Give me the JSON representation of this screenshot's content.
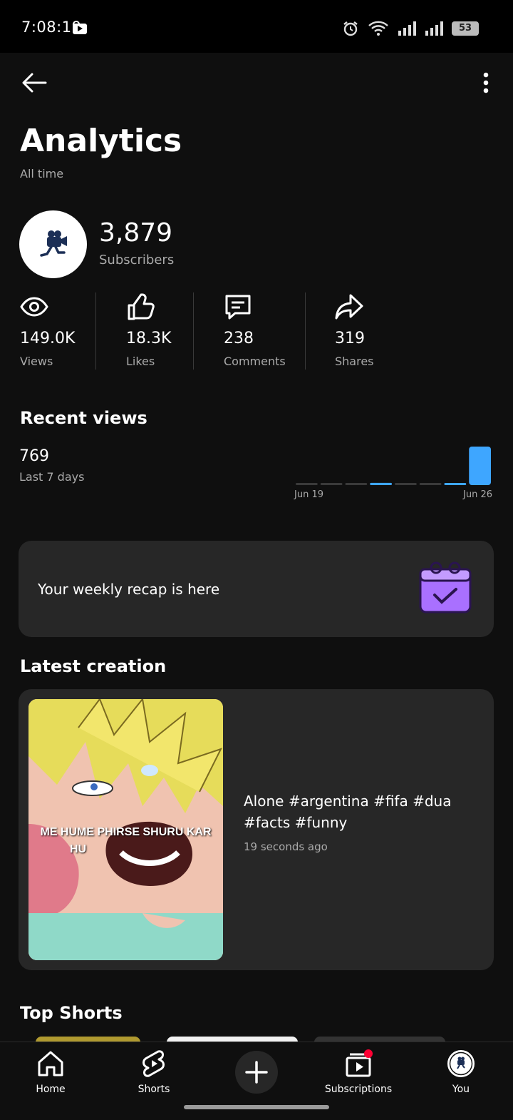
{
  "status": {
    "time": "7:08:19",
    "battery": "53"
  },
  "header": {
    "title": "Analytics",
    "subtitle": "All time"
  },
  "channel": {
    "subscribers": "3,879",
    "subscribers_label": "Subscribers"
  },
  "stats": [
    {
      "icon": "eye-icon",
      "value": "149.0K",
      "label": "Views"
    },
    {
      "icon": "thumbs-up-icon",
      "value": "18.3K",
      "label": "Likes"
    },
    {
      "icon": "comment-icon",
      "value": "238",
      "label": "Comments"
    },
    {
      "icon": "share-icon",
      "value": "319",
      "label": "Shares"
    }
  ],
  "recent": {
    "title": "Recent views",
    "value": "769",
    "label": "Last 7 days"
  },
  "chart_data": {
    "type": "bar",
    "categories": [
      "Jun 19",
      "Jun 20",
      "Jun 21",
      "Jun 22",
      "Jun 23",
      "Jun 24",
      "Jun 25",
      "Jun 26"
    ],
    "values": [
      0,
      0,
      0,
      40,
      0,
      0,
      20,
      700
    ],
    "tick_labels": [
      "Jun 19",
      "Jun 26"
    ],
    "highlight_color": "#3ea6ff",
    "base_color": "#3a3a3a"
  },
  "recap": {
    "text": "Your weekly recap is here",
    "accent": "#a970ff"
  },
  "latest": {
    "section_title": "Latest creation",
    "video_title": "Alone #argentina #fifa #dua #facts #funny",
    "time_ago": "19 seconds ago",
    "thumb_caption_1": "ME HUME PHIRSE SHURU KAR",
    "thumb_caption_2": "HU"
  },
  "top_shorts": {
    "title": "Top Shorts"
  },
  "nav": {
    "home": "Home",
    "shorts": "Shorts",
    "subscriptions": "Subscriptions",
    "you": "You",
    "badge_color": "#ff0033"
  }
}
